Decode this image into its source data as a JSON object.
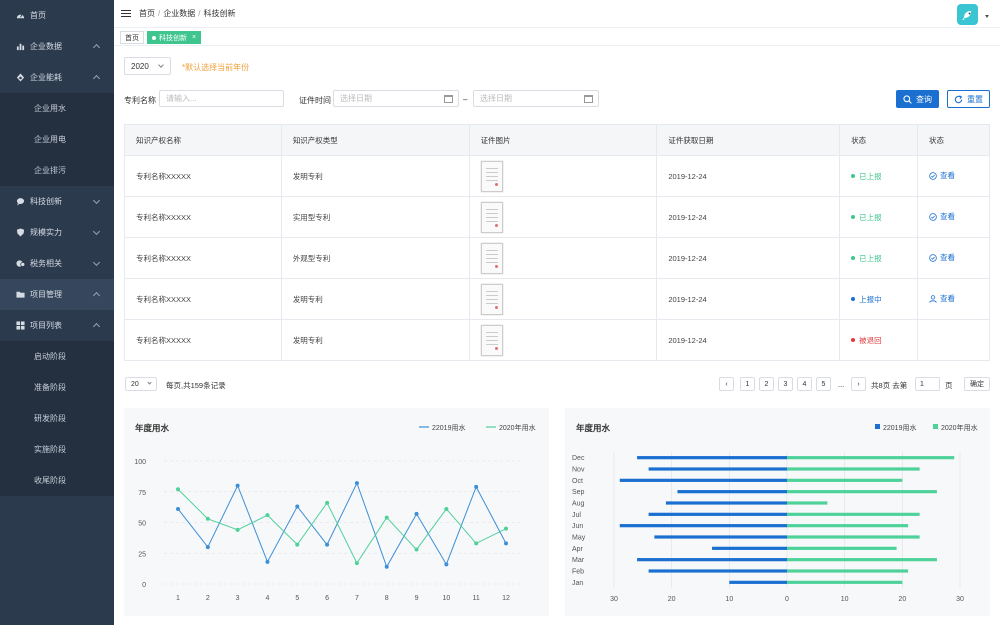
{
  "sidebar": {
    "items": [
      {
        "label": "首页",
        "icon": "dashboard-icon"
      },
      {
        "label": "企业数据",
        "icon": "bar-chart-icon"
      },
      {
        "label": "企业能耗",
        "icon": "flame-icon"
      },
      {
        "label": "企业用水"
      },
      {
        "label": "企业用电"
      },
      {
        "label": "企业排污"
      },
      {
        "label": "科技创新",
        "icon": "chat-icon"
      },
      {
        "label": "规模实力",
        "icon": "shield-icon"
      },
      {
        "label": "税务相关",
        "icon": "tax-icon"
      },
      {
        "label": "项目管理",
        "icon": "folder-icon"
      },
      {
        "label": "项目列表",
        "icon": "grid-icon"
      },
      {
        "label": "启动阶段"
      },
      {
        "label": "准备阶段"
      },
      {
        "label": "研发阶段"
      },
      {
        "label": "实施阶段"
      },
      {
        "label": "收尾阶段"
      }
    ]
  },
  "header": {
    "crumbs": [
      "首页",
      "企业数据",
      "科技创新"
    ]
  },
  "tags": {
    "home": "首页",
    "current": "科技创新"
  },
  "filters": {
    "year": "2020",
    "year_hint": "*默认选择当前年份",
    "patent_label": "专利名称",
    "patent_placeholder": "请输入...",
    "date_label": "证件时间",
    "date_placeholder": "选择日期",
    "date_sep": "–",
    "query": "查询",
    "reset": "重置"
  },
  "table": {
    "headers": [
      "知识产权名称",
      "知识产权类型",
      "证件图片",
      "证件获取日期",
      "状态",
      "状态"
    ],
    "rows": [
      {
        "name": "专利名称XXXXX",
        "type": "发明专利",
        "date": "2019-12-24",
        "status": "已上报",
        "status_color": "#3fc68e",
        "action": "查看",
        "action_icon": "check-circle-icon"
      },
      {
        "name": "专利名称XXXXX",
        "type": "实用型专利",
        "date": "2019-12-24",
        "status": "已上报",
        "status_color": "#3fc68e",
        "action": "查看",
        "action_icon": "check-circle-icon"
      },
      {
        "name": "专利名称XXXXX",
        "type": "外观型专利",
        "date": "2019-12-24",
        "status": "已上报",
        "status_color": "#3fc68e",
        "action": "查看",
        "action_icon": "check-circle-icon"
      },
      {
        "name": "专利名称XXXXX",
        "type": "发明专利",
        "date": "2019-12-24",
        "status": "上报中",
        "status_color": "#1a6fd0",
        "action": "查看",
        "action_icon": "user-icon"
      },
      {
        "name": "专利名称XXXXX",
        "type": "发明专利",
        "date": "2019-12-24",
        "status": "被退回",
        "status_color": "#e03a3a",
        "action": "",
        "action_icon": ""
      }
    ]
  },
  "pagination": {
    "page_size": "20",
    "per_page_text": "每页,共159条记录",
    "pages": [
      "1",
      "2",
      "3",
      "4",
      "5"
    ],
    "ellipsis": "...",
    "total_text": "共8页 去第",
    "goto_value": "1",
    "page_unit": "页",
    "confirm": "确定"
  },
  "chart_data": [
    {
      "type": "line",
      "title": "年度用水",
      "x": [
        1,
        2,
        3,
        4,
        5,
        6,
        7,
        8,
        9,
        10,
        11,
        12
      ],
      "ylim": [
        0,
        100
      ],
      "yticks": [
        0,
        25,
        50,
        75,
        100
      ],
      "grid": true,
      "legend_position": "top-right",
      "series": [
        {
          "name": "22019用水",
          "color": "#3d8fd6",
          "values": [
            61,
            30,
            80,
            18,
            63,
            32,
            82,
            14,
            57,
            16,
            79,
            33
          ]
        },
        {
          "name": "2020年用水",
          "color": "#4fd19a",
          "values": [
            77,
            53,
            44,
            56,
            32,
            66,
            17,
            54,
            28,
            61,
            33,
            45
          ]
        }
      ]
    },
    {
      "type": "bar",
      "orientation": "horizontal",
      "title": "年度用水",
      "categories": [
        "Dec",
        "Nov",
        "Oct",
        "Sep",
        "Aug",
        "Jul",
        "Jun",
        "May",
        "Apr",
        "Mar",
        "Feb",
        "Jan"
      ],
      "xticks": [
        "30",
        "20",
        "10",
        "0",
        "10",
        "20",
        "30"
      ],
      "xlim": [
        -30,
        30
      ],
      "legend_position": "top-right",
      "series": [
        {
          "name": "22019用水",
          "color": "#1a6fd0",
          "values": [
            26,
            24,
            29,
            19,
            21,
            24,
            29,
            23,
            13,
            26,
            24,
            10
          ]
        },
        {
          "name": "2020年用水",
          "color": "#4fd19a",
          "values": [
            29,
            23,
            20,
            26,
            7,
            23,
            21,
            23,
            19,
            26,
            21,
            20
          ]
        }
      ]
    }
  ]
}
